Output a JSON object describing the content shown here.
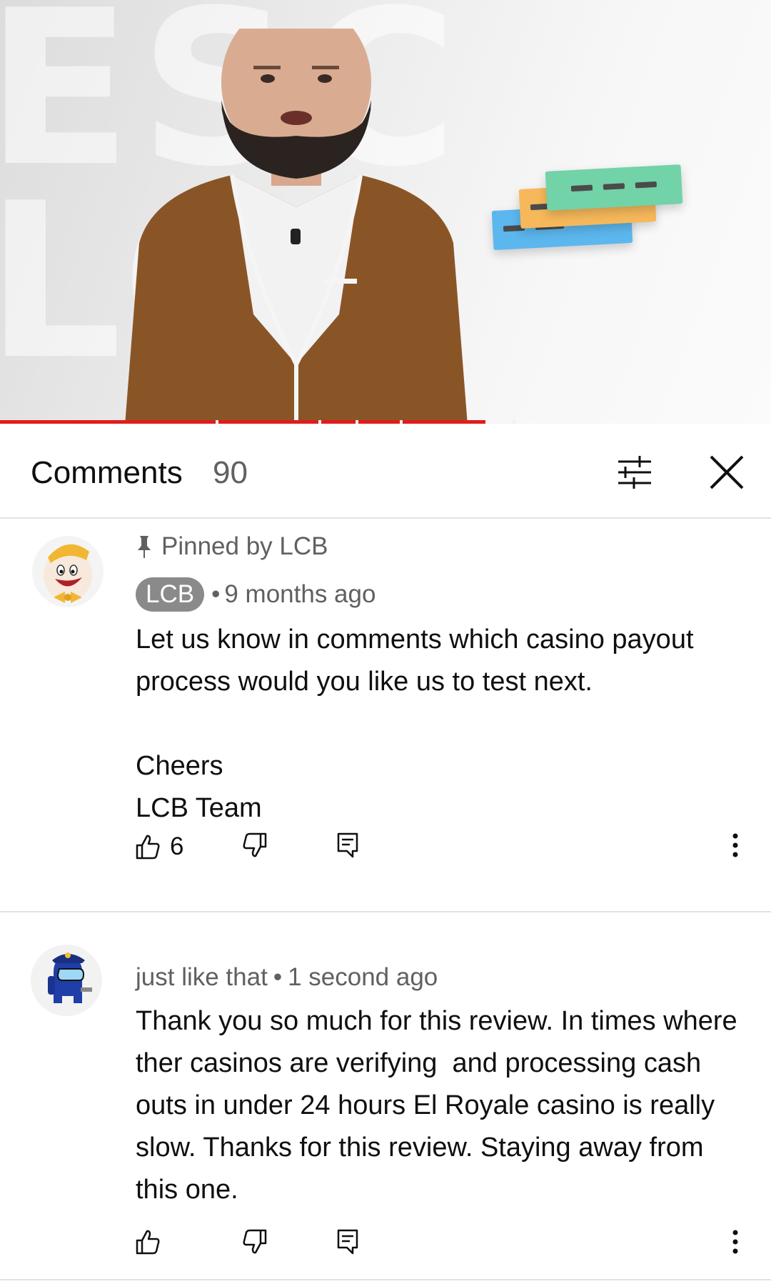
{
  "header": {
    "title": "Comments",
    "count": "90"
  },
  "video": {
    "progress_fraction": 0.63
  },
  "comments": [
    {
      "pinned_label": "Pinned by LCB",
      "author": "LCB",
      "time": "9 months ago",
      "text": "Let us know in comments which casino payout process would you like us to test next.\n\nCheers\nLCB Team",
      "likes": "6"
    },
    {
      "author": "just like that",
      "time": "1 second ago",
      "text": "Thank you so much for this review. In times where ther casinos are verifying  and processing cash outs in under 24 hours El Royale casino is really slow. Thanks for this review. Staying away from this one.",
      "likes": ""
    }
  ],
  "colors": {
    "progress": "#e01c1c",
    "secondary_text": "#606060",
    "badge": "#8a8a8a"
  }
}
